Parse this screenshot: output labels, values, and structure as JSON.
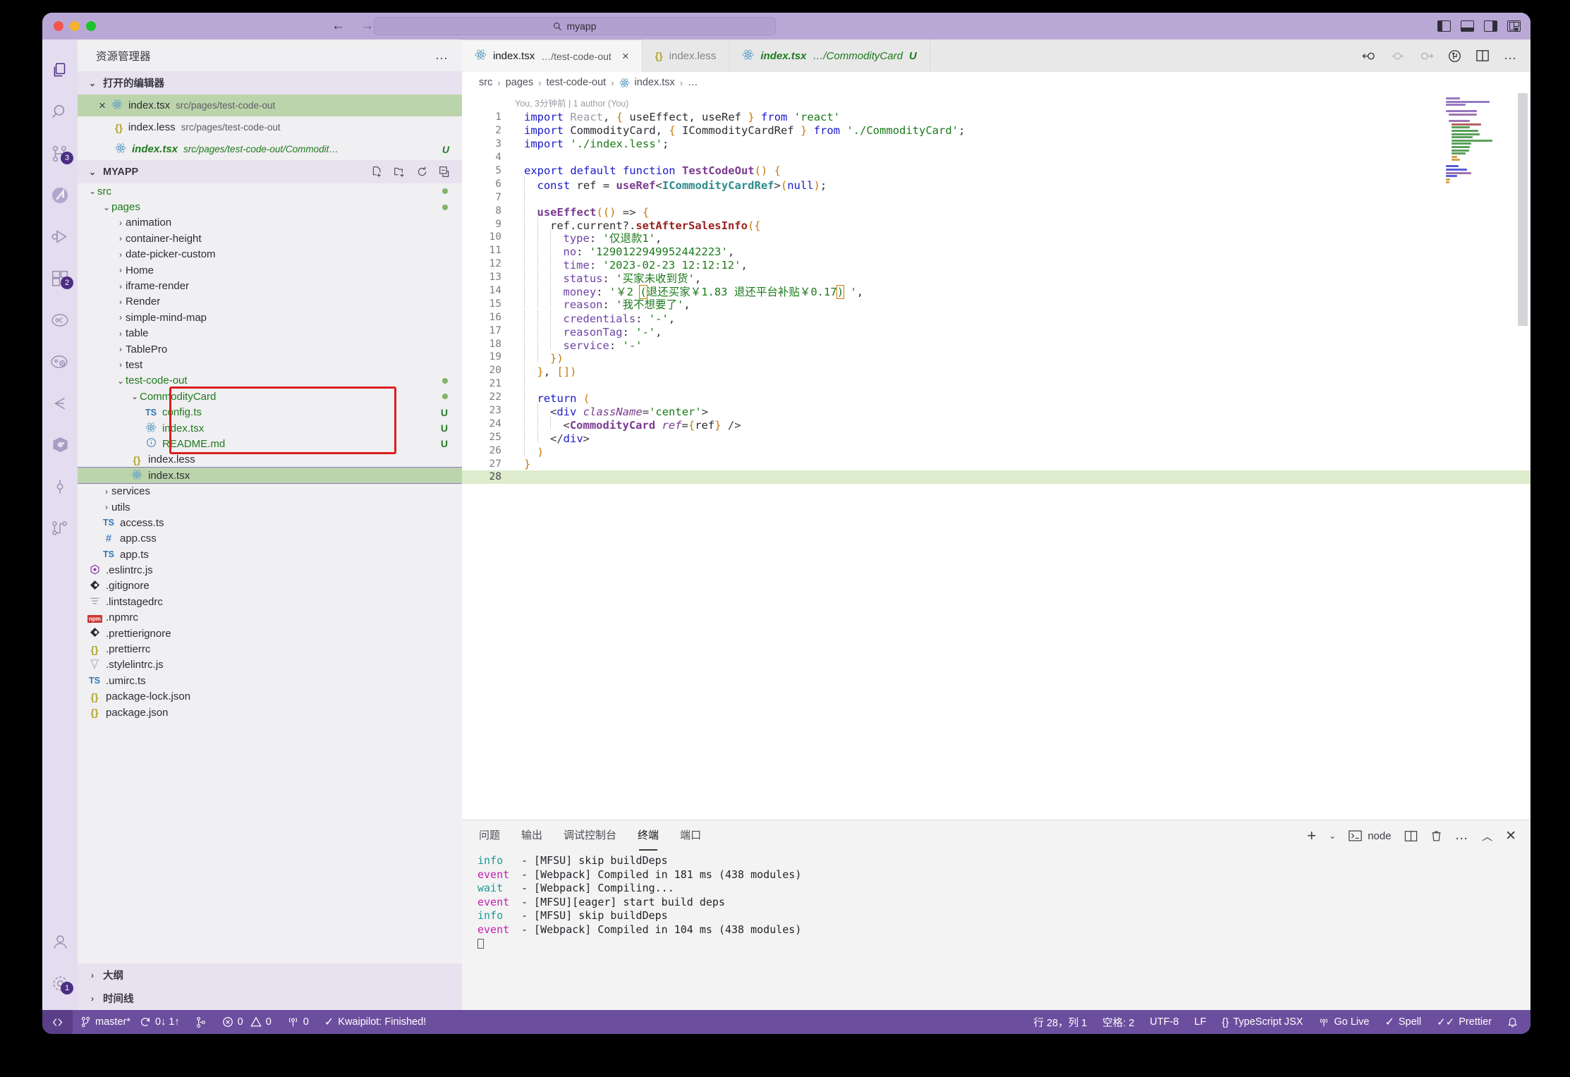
{
  "titlebar": {
    "search_text": "myapp",
    "back_icon": "arrow-left-icon",
    "forward_icon": "arrow-right-icon",
    "search_icon": "search-icon",
    "layout_icons": [
      "toggle-primary-sidebar-icon",
      "toggle-panel-icon",
      "toggle-secondary-sidebar-icon",
      "customize-layout-icon"
    ]
  },
  "activity_bar": {
    "items": [
      {
        "name": "explorer",
        "icon": "files-icon",
        "badge": ""
      },
      {
        "name": "search",
        "icon": "search-icon",
        "badge": ""
      },
      {
        "name": "source-control",
        "icon": "source-control-icon",
        "badge": "3"
      },
      {
        "name": "kwaipilot",
        "icon": "kwaipilot-icon",
        "badge": ""
      },
      {
        "name": "run-and-debug",
        "icon": "run-debug-icon",
        "badge": ""
      },
      {
        "name": "extensions",
        "icon": "extensions-icon",
        "badge": "2"
      },
      {
        "name": "test-explorer",
        "icon": "beaker-node-icon",
        "badge": ""
      },
      {
        "name": "test-coverage",
        "icon": "node-eye-icon",
        "badge": ""
      },
      {
        "name": "import-cost",
        "icon": "chevron-box-icon",
        "badge": ""
      },
      {
        "name": "bytedance",
        "icon": "hex-icon",
        "badge": ""
      },
      {
        "name": "code-marker",
        "icon": "circle-line-icon",
        "badge": ""
      },
      {
        "name": "git-graph",
        "icon": "git-graph-icon",
        "badge": ""
      }
    ],
    "bottom": [
      {
        "name": "accounts",
        "icon": "account-icon",
        "badge": ""
      },
      {
        "name": "settings",
        "icon": "gear-icon",
        "badge": "1"
      }
    ]
  },
  "sidebar": {
    "title": "资源管理器",
    "more_actions": "…",
    "open_editors": {
      "label": "打开的编辑器",
      "items": [
        {
          "close": "×",
          "icon": "react-icon",
          "name": "index.tsx",
          "path": "src/pages/test-code-out",
          "status": "",
          "selected": true,
          "modified": false
        },
        {
          "close": "",
          "icon": "less-icon",
          "name": "index.less",
          "path": "src/pages/test-code-out",
          "status": "",
          "selected": false,
          "modified": false
        },
        {
          "close": "",
          "icon": "react-icon",
          "name": "index.tsx",
          "path": "src/pages/test-code-out/Commodit…",
          "status": "U",
          "selected": false,
          "modified": true
        }
      ]
    },
    "workspace": {
      "label": "MYAPP",
      "actions": [
        "new-file-icon",
        "new-folder-icon",
        "refresh-icon",
        "collapse-all-icon"
      ],
      "tree": [
        {
          "depth": 1,
          "name": "src",
          "type": "folder",
          "expanded": true,
          "green": true,
          "dot": true
        },
        {
          "depth": 2,
          "name": "pages",
          "type": "folder",
          "expanded": true,
          "green": true,
          "dot": true
        },
        {
          "depth": 3,
          "name": "animation",
          "type": "folder",
          "expanded": false
        },
        {
          "depth": 3,
          "name": "container-height",
          "type": "folder",
          "expanded": false
        },
        {
          "depth": 3,
          "name": "date-picker-custom",
          "type": "folder",
          "expanded": false
        },
        {
          "depth": 3,
          "name": "Home",
          "type": "folder",
          "expanded": false
        },
        {
          "depth": 3,
          "name": "iframe-render",
          "type": "folder",
          "expanded": false
        },
        {
          "depth": 3,
          "name": "Render",
          "type": "folder",
          "expanded": false
        },
        {
          "depth": 3,
          "name": "simple-mind-map",
          "type": "folder",
          "expanded": false
        },
        {
          "depth": 3,
          "name": "table",
          "type": "folder",
          "expanded": false
        },
        {
          "depth": 3,
          "name": "TablePro",
          "type": "folder",
          "expanded": false
        },
        {
          "depth": 3,
          "name": "test",
          "type": "folder",
          "expanded": false
        },
        {
          "depth": 3,
          "name": "test-code-out",
          "type": "folder",
          "expanded": true,
          "green": true,
          "dot": true
        },
        {
          "depth": 4,
          "name": "CommodityCard",
          "type": "folder",
          "expanded": true,
          "green": true,
          "dot": true,
          "boxed": true
        },
        {
          "depth": 5,
          "name": "config.ts",
          "type": "ts",
          "green": true,
          "badge": "U",
          "boxed": true
        },
        {
          "depth": 5,
          "name": "index.tsx",
          "type": "react",
          "green": true,
          "badge": "U",
          "boxed": true
        },
        {
          "depth": 5,
          "name": "README.md",
          "type": "md",
          "green": true,
          "badge": "U",
          "boxed": true
        },
        {
          "depth": 4,
          "name": "index.less",
          "type": "less"
        },
        {
          "depth": 4,
          "name": "index.tsx",
          "type": "react",
          "selected": true
        },
        {
          "depth": 2,
          "name": "services",
          "type": "folder",
          "expanded": false
        },
        {
          "depth": 2,
          "name": "utils",
          "type": "folder",
          "expanded": false
        },
        {
          "depth": 2,
          "name": "access.ts",
          "type": "ts"
        },
        {
          "depth": 2,
          "name": "app.css",
          "type": "css"
        },
        {
          "depth": 2,
          "name": "app.ts",
          "type": "ts"
        },
        {
          "depth": 1,
          "name": ".eslintrc.js",
          "type": "eslint"
        },
        {
          "depth": 1,
          "name": ".gitignore",
          "type": "git"
        },
        {
          "depth": 1,
          "name": ".lintstagedrc",
          "type": "lines"
        },
        {
          "depth": 1,
          "name": ".npmrc",
          "type": "npm"
        },
        {
          "depth": 1,
          "name": ".prettierignore",
          "type": "git"
        },
        {
          "depth": 1,
          "name": ".prettierrc",
          "type": "less"
        },
        {
          "depth": 1,
          "name": ".stylelintrc.js",
          "type": "stylelint"
        },
        {
          "depth": 1,
          "name": ".umirc.ts",
          "type": "ts"
        },
        {
          "depth": 1,
          "name": "package-lock.json",
          "type": "less"
        },
        {
          "depth": 1,
          "name": "package.json",
          "type": "less"
        }
      ]
    },
    "outline_label": "大纲",
    "timeline_label": "时间线"
  },
  "editor": {
    "tabs": [
      {
        "icon": "react-icon",
        "name": "index.tsx",
        "path": "…/test-code-out",
        "active": true,
        "close": "×",
        "status": ""
      },
      {
        "icon": "less-icon",
        "name": "index.less",
        "path": "",
        "active": false,
        "close": "",
        "status": ""
      },
      {
        "icon": "react-icon",
        "name": "index.tsx",
        "path": "…/CommodityCard",
        "active": false,
        "close": "",
        "status": "U",
        "modified": true
      }
    ],
    "tab_actions": [
      "split-diff-icon",
      "prev-change-icon",
      "next-change-icon",
      "source-control-inline-icon",
      "split-editor-icon",
      "more-actions-icon"
    ],
    "breadcrumb": [
      "src",
      "pages",
      "test-code-out",
      "index.tsx",
      "…"
    ],
    "breadcrumb_file_icon": "react-icon",
    "blame": "You, 3分钟前 | 1 author (You)",
    "code_lines": [
      {
        "n": 1,
        "html": "<span class=\"kw\">import</span> <span class=\"cls\">React</span><span class=\"plain\">, </span><span class=\"brkt\">{</span><span class=\"plain\"> useEffect, useRef </span><span class=\"brkt\">}</span> <span class=\"kw\">from</span> <span class=\"str\">'react'</span>"
      },
      {
        "n": 2,
        "html": "<span class=\"kw\">import</span> <span class=\"plain\">CommodityCard, </span><span class=\"brkt\">{</span><span class=\"plain\"> ICommodityCardRef </span><span class=\"brkt\">}</span> <span class=\"kw\">from</span> <span class=\"str\">'./CommodityCard'</span><span class=\"plain\">;</span>"
      },
      {
        "n": 3,
        "html": "<span class=\"kw\">import</span> <span class=\"str\">'./index.less'</span><span class=\"plain\">;</span>"
      },
      {
        "n": 4,
        "html": ""
      },
      {
        "n": 5,
        "html": "<span class=\"kw\">export default function</span> <span class=\"fn\">TestCodeOut</span><span class=\"brkt\">()</span> <span class=\"brkt\">{</span>"
      },
      {
        "n": 6,
        "indent": 1,
        "html": "<span class=\"kw\">const</span> <span class=\"plain\">ref = </span><span class=\"fn\">useRef</span><span class=\"op\">&lt;</span><span class=\"type\">ICommodityCardRef</span><span class=\"op\">&gt;</span><span class=\"brkt\">(</span><span class=\"kw\">null</span><span class=\"brkt\">)</span><span class=\"plain\">;</span>"
      },
      {
        "n": 7,
        "indent": 1,
        "html": ""
      },
      {
        "n": 8,
        "indent": 1,
        "html": "<span class=\"fn\">useEffect</span><span class=\"brkt\">((</span><span class=\"brkt\">)</span> <span class=\"op\">=&gt;</span> <span class=\"brkt\">{</span>"
      },
      {
        "n": 9,
        "indent": 2,
        "html": "<span class=\"plain\">ref.current?.</span><span class=\"fn2\">setAfterSalesInfo</span><span class=\"brkt\">({</span>"
      },
      {
        "n": 10,
        "indent": 3,
        "html": "<span class=\"var\">type</span><span class=\"plain\">: </span><span class=\"str\">'仅退款1'</span><span class=\"plain\">,</span>"
      },
      {
        "n": 11,
        "indent": 3,
        "html": "<span class=\"var\">no</span><span class=\"plain\">: </span><span class=\"str\">'1290122949952442223'</span><span class=\"plain\">,</span>"
      },
      {
        "n": 12,
        "indent": 3,
        "html": "<span class=\"var\">time</span><span class=\"plain\">: </span><span class=\"str\">'2023-02-23 12:12:12'</span><span class=\"plain\">,</span>"
      },
      {
        "n": 13,
        "indent": 3,
        "html": "<span class=\"var\">status</span><span class=\"plain\">: </span><span class=\"str\">'买家未收到货'</span><span class=\"plain\">,</span>"
      },
      {
        "n": 14,
        "indent": 3,
        "html": "<span class=\"var\">money</span><span class=\"plain\">: </span><span class=\"str\">'￥2 </span><span class=\"str bmatch\">(</span><span class=\"str\">退还买家￥1.83 退还平台补贴￥0.17</span><span class=\"str bmatch\">)</span><span class=\"str\"> '</span><span class=\"plain\">,</span>"
      },
      {
        "n": 15,
        "indent": 3,
        "html": "<span class=\"var\">reason</span><span class=\"plain\">: </span><span class=\"str\">'我不想要了'</span><span class=\"plain\">,</span>"
      },
      {
        "n": 16,
        "indent": 3,
        "html": "<span class=\"var\">credentials</span><span class=\"plain\">: </span><span class=\"str\">'-'</span><span class=\"plain\">,</span>"
      },
      {
        "n": 17,
        "indent": 3,
        "html": "<span class=\"var\">reasonTag</span><span class=\"plain\">: </span><span class=\"str\">'-'</span><span class=\"plain\">,</span>"
      },
      {
        "n": 18,
        "indent": 3,
        "html": "<span class=\"var\">service</span><span class=\"plain\">: </span><span class=\"str\">'-'</span>"
      },
      {
        "n": 19,
        "indent": 2,
        "html": "<span class=\"brkt\">})</span>"
      },
      {
        "n": 20,
        "indent": 1,
        "html": "<span class=\"brkt\">}</span><span class=\"plain\">, </span><span class=\"brkt\">[])</span>"
      },
      {
        "n": 21,
        "indent": 1,
        "html": ""
      },
      {
        "n": 22,
        "indent": 1,
        "html": "<span class=\"kw\">return</span> <span class=\"brkt\">(</span>"
      },
      {
        "n": 23,
        "indent": 2,
        "html": "<span class=\"op\">&lt;</span><span class=\"tagn\">div</span> <span class=\"attr\">className</span><span class=\"op\">=</span><span class=\"str\">'center'</span><span class=\"op\">&gt;</span>"
      },
      {
        "n": 24,
        "indent": 3,
        "html": "<span class=\"op\">&lt;</span><span class=\"fn\">CommodityCard</span> <span class=\"attr\">ref</span><span class=\"op\">=</span><span class=\"brkt\">{</span><span class=\"plain\">ref</span><span class=\"brkt\">}</span> <span class=\"op\">/&gt;</span>"
      },
      {
        "n": 25,
        "indent": 2,
        "html": "<span class=\"op\">&lt;/</span><span class=\"tagn\">div</span><span class=\"op\">&gt;</span>"
      },
      {
        "n": 26,
        "indent": 1,
        "html": "<span class=\"brkt\">)</span>"
      },
      {
        "n": 27,
        "html": "<span class=\"brkt\">}</span>"
      },
      {
        "n": 28,
        "html": "",
        "current": true
      }
    ]
  },
  "panel": {
    "tabs": [
      {
        "label": "问题",
        "active": false
      },
      {
        "label": "输出",
        "active": false
      },
      {
        "label": "调试控制台",
        "active": false
      },
      {
        "label": "终端",
        "active": true
      },
      {
        "label": "端口",
        "active": false
      }
    ],
    "actions": [
      "new-terminal-icon",
      "terminal-dropdown-icon",
      "shell-node-icon",
      "split-terminal-icon",
      "kill-terminal-icon",
      "more-actions-icon",
      "maximize-panel-icon",
      "close-panel-icon"
    ],
    "shell_name": "node",
    "terminal_lines": [
      {
        "level": "info",
        "text": "- [MFSU] skip buildDeps"
      },
      {
        "level": "event",
        "text": "- [Webpack] Compiled in 181 ms (438 modules)"
      },
      {
        "level": "wait",
        "text": "- [Webpack] Compiling..."
      },
      {
        "level": "event",
        "text": "- [MFSU][eager] start build deps"
      },
      {
        "level": "info",
        "text": "- [MFSU] skip buildDeps"
      },
      {
        "level": "event",
        "text": "- [Webpack] Compiled in 104 ms (438 modules)"
      }
    ]
  },
  "status_bar": {
    "left": [
      {
        "name": "remote-indicator",
        "icon": "remote-icon",
        "label": ""
      },
      {
        "name": "branch",
        "icon": "git-branch-icon",
        "label": "master*"
      },
      {
        "name": "sync-changes",
        "icon": "sync-icon",
        "label": "0↓ 1↑"
      },
      {
        "name": "source-control-graph",
        "icon": "git-graph-icon",
        "label": ""
      },
      {
        "name": "problems",
        "icon": "error-warning-icon",
        "label": "0  0"
      },
      {
        "name": "ports",
        "icon": "broadcast-icon",
        "label": "0"
      },
      {
        "name": "kwaipilot-status",
        "icon": "check-icon",
        "label": "Kwaipilot: Finished!"
      }
    ],
    "right": [
      {
        "name": "cursor-position",
        "label": "行 28，列 1"
      },
      {
        "name": "indentation",
        "label": "空格: 2"
      },
      {
        "name": "encoding",
        "label": "UTF-8"
      },
      {
        "name": "eol",
        "label": "LF"
      },
      {
        "name": "language-mode",
        "icon": "braces-icon",
        "label": "TypeScript JSX"
      },
      {
        "name": "go-live",
        "icon": "broadcast-icon",
        "label": "Go Live"
      },
      {
        "name": "spell-checker",
        "icon": "check-icon",
        "label": "Spell"
      },
      {
        "name": "prettier",
        "icon": "check-check-icon",
        "label": "Prettier"
      },
      {
        "name": "notifications",
        "icon": "bell-icon",
        "label": ""
      }
    ]
  },
  "colors": {
    "titlebar": "#b9a8d6",
    "activity_bar": "#e3ddef",
    "sidebar": "#f0eff1",
    "status_bar": "#6c4e9e",
    "selection_green": "#bcd4ac",
    "highlight_box": "#d81f1f",
    "modified_green": "#1f7a1f"
  }
}
